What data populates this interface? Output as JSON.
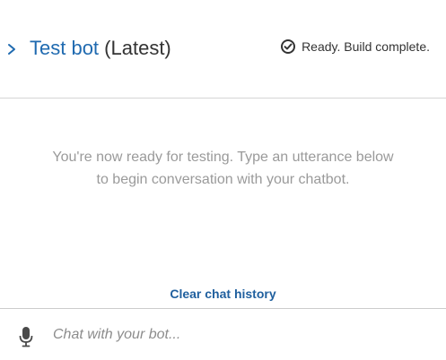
{
  "header": {
    "bot_name": "Test bot",
    "version": "(Latest)",
    "status_text": "Ready. Build complete."
  },
  "icons": {
    "expand": "chevron-right-icon",
    "status": "check-circle-icon",
    "mic": "microphone-icon"
  },
  "conversation": {
    "empty_line1": "You're now ready for testing. Type an utterance below",
    "empty_line2": "to begin conversation with your chatbot."
  },
  "actions": {
    "clear_history": "Clear chat history"
  },
  "input": {
    "placeholder": "Chat with your bot...",
    "value": ""
  },
  "colors": {
    "link": "#1f6ab0",
    "muted_text": "#9a9a9a",
    "divider": "#d5d5d5"
  }
}
